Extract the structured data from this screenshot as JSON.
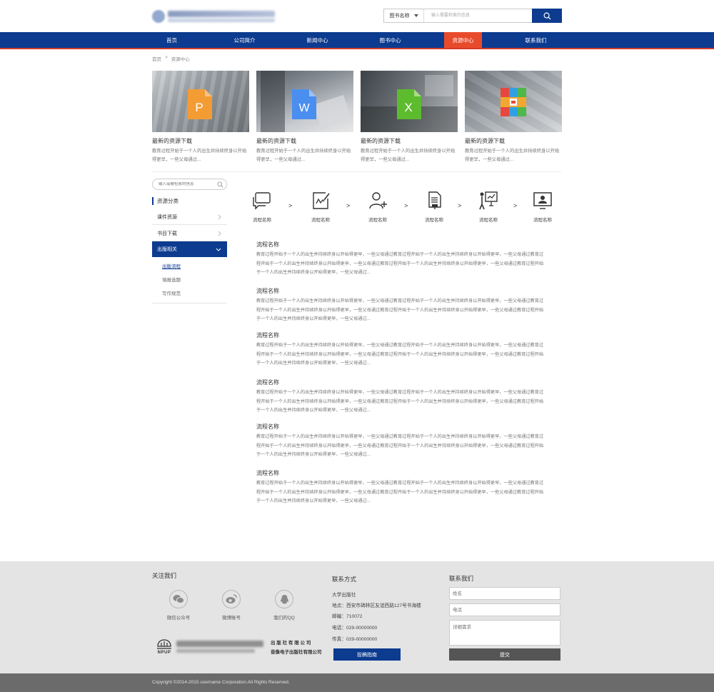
{
  "header": {
    "search_scope": "图书名称",
    "search_placeholder": "输入需要检索的信息"
  },
  "nav": {
    "items": [
      {
        "label": "首页"
      },
      {
        "label": "公司简介"
      },
      {
        "label": "新闻中心"
      },
      {
        "label": "图书中心"
      },
      {
        "label": "资源中心",
        "active": true
      },
      {
        "label": "联系我们"
      }
    ]
  },
  "breadcrumb": {
    "home": "首页",
    "separator": ">",
    "current": "资源中心"
  },
  "cards": [
    {
      "title": "最新的资源下载",
      "desc": "教育过程开始于一个人的出生并持续终身以开始得更早，一些父母通过...",
      "icon": "ppt-file-icon",
      "letter": "P",
      "color": "#f39c34"
    },
    {
      "title": "最新的资源下载",
      "desc": "教育过程开始于一个人的出生并持续终身以开始得更早，一些父母通过...",
      "icon": "word-file-icon",
      "letter": "W",
      "color": "#4a8ef0"
    },
    {
      "title": "最新的资源下载",
      "desc": "教育过程开始于一个人的出生并持续终身以开始得更早，一些父母通过...",
      "icon": "excel-file-icon",
      "letter": "X",
      "color": "#5dbb2e"
    },
    {
      "title": "最新的资源下载",
      "desc": "教育过程开始于一个人的出生并持续终身以开始得更早，一些父母通过...",
      "icon": "archive-file-icon",
      "letter": "",
      "color": "#2fa1e3"
    }
  ],
  "sidebar": {
    "search_placeholder": "输入需要检索的信息",
    "heading": "资源分类",
    "items": [
      {
        "label": "课件资源"
      },
      {
        "label": "书目下载"
      },
      {
        "label": "出版相关",
        "active": true
      }
    ],
    "subitems": [
      {
        "label": "出版流程",
        "active": true
      },
      {
        "label": "填报选题"
      },
      {
        "label": "写作规范"
      }
    ]
  },
  "process": {
    "steps": [
      {
        "label": "流程名称",
        "icon": "chat-bubbles-icon"
      },
      {
        "label": "流程名称",
        "icon": "sign-document-icon"
      },
      {
        "label": "流程名称",
        "icon": "add-user-icon"
      },
      {
        "label": "流程名称",
        "icon": "document-stamp-icon"
      },
      {
        "label": "流程名称",
        "icon": "presentation-icon"
      },
      {
        "label": "流程名称",
        "icon": "monitor-user-icon"
      }
    ],
    "arrow": ">"
  },
  "articles": [
    {
      "title": "流程名称",
      "body": "教育过程开始于一个人的出生并持续终身以开始得更早，一些父母通过教育过程开始于一个人的出生并持续终身以开始得更早，一些父母通过教育过程开始于一个人的出生并持续终身以开始得更早，一些父母通过教育过程开始于一个人的出生并持续终身以开始得更早，一些父母通过教育过程开始于一个人的出生并持续终身以开始得更早，一些父母通过..."
    },
    {
      "title": "流程名称",
      "body": "教育过程开始于一个人的出生并持续终身以开始得更早，一些父母通过教育过程开始于一个人的出生并持续终身以开始得更早，一些父母通过教育过程开始于一个人的出生并持续终身以开始得更早，一些父母通过教育过程开始于一个人的出生并持续终身以开始得更早，一些父母通过教育过程开始于一个人的出生并持续终身以开始得更早，一些父母通过..."
    },
    {
      "title": "流程名称",
      "body": "教育过程开始于一个人的出生并持续终身以开始得更早，一些父母通过教育过程开始于一个人的出生并持续终身以开始得更早，一些父母通过教育过程开始于一个人的出生并持续终身以开始得更早，一些父母通过教育过程开始于一个人的出生并持续终身以开始得更早，一些父母通过教育过程开始于一个人的出生并持续终身以开始得更早，一些父母通过..."
    },
    {
      "title": "流程名称",
      "body": "教育过程开始于一个人的出生并持续终身以开始得更早，一些父母通过教育过程开始于一个人的出生并持续终身以开始得更早，一些父母通过教育过程开始于一个人的出生并持续终身以开始得更早，一些父母通过教育过程开始于一个人的出生并持续终身以开始得更早，一些父母通过教育过程开始于一个人的出生并持续终身以开始得更早，一些父母通过..."
    },
    {
      "title": "流程名称",
      "body": "教育过程开始于一个人的出生并持续终身以开始得更早，一些父母通过教育过程开始于一个人的出生并持续终身以开始得更早，一些父母通过教育过程开始于一个人的出生并持续终身以开始得更早，一些父母通过教育过程开始于一个人的出生并持续终身以开始得更早，一些父母通过教育过程开始于一个人的出生并持续终身以开始得更早，一些父母通过..."
    },
    {
      "title": "流程名称",
      "body": "教育过程开始于一个人的出生并持续终身以开始得更早，一些父母通过教育过程开始于一个人的出生并持续终身以开始得更早，一些父母通过教育过程开始于一个人的出生并持续终身以开始得更早，一些父母通过教育过程开始于一个人的出生并持续终身以开始得更早，一些父母通过教育过程开始于一个人的出生并持续终身以开始得更早，一些父母通过..."
    }
  ],
  "footer": {
    "follow_title": "关注我们",
    "social": [
      {
        "label": "微信公众号",
        "icon": "wechat-icon"
      },
      {
        "label": "微博账号",
        "icon": "weibo-icon"
      },
      {
        "label": "我们的QQ",
        "icon": "qq-icon"
      }
    ],
    "npup": "NPUP",
    "publisher_lines": [
      "出 版 社 有 限 公 司",
      "音像电子出版社有限公司"
    ],
    "contact_title": "联系方式",
    "contact_lines": [
      "大学出版社",
      "地点：西安市碑林区友谊西路127号书海楼",
      "邮编：710072",
      "电话：029-00000000",
      "传真：029-00000000"
    ],
    "guide_button": "投稿指南",
    "form_title": "联系我们",
    "name_placeholder": "姓名",
    "phone_placeholder": "电话",
    "detail_placeholder": "详细需求",
    "submit_button": "提交",
    "copyright": "Copyright ©2014-2015 username Corporation.All Rights Reserved."
  },
  "colors": {
    "brand": "#0c3b8f",
    "accent": "#e84b2c",
    "footer_bg": "#e4e4e4"
  }
}
